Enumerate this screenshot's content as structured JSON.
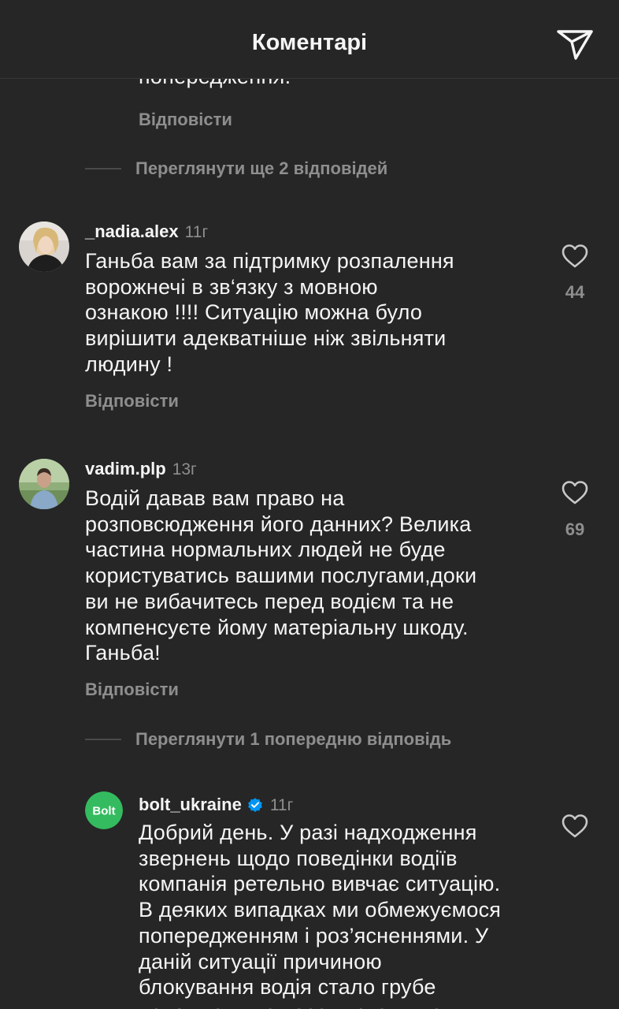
{
  "header": {
    "title": "Коментарі",
    "send_icon": "send-icon"
  },
  "prev_comment": {
    "text_tail": "попередження.",
    "reply_label": "Відповісти"
  },
  "thread1_more": "Переглянути ще 2 відповідей",
  "comments": [
    {
      "username": "_nadia.alex",
      "time": "11г",
      "text": "Ганьба вам за підтримку розпалення\nворожнечі в зв‘язку з мовною\nознакою !!!! Ситуацію можна було\nвирішити адекватніше ніж звільняти\nлюдину !",
      "likes": "44",
      "reply_label": "Відповісти"
    },
    {
      "username": "vadim.plp",
      "time": "13г",
      "text": "Водій давав вам право на\nрозповсюдження його данних? Велика\nчастина нормальних людей не буде\nкористуватись вашими послугами,доки\nви не вибачитесь перед водієм та не\nкомпенсуєте йому матеріальну шкоду.\nГаньба!",
      "likes": "69",
      "reply_label": "Відповісти"
    }
  ],
  "thread2_more": "Переглянути 1 попередню відповідь",
  "brand_reply": {
    "username": "bolt_ukraine",
    "verified": true,
    "time": "11г",
    "avatar_text": "Bolt",
    "text": "Добрий день. У разі надходження\nзвернень щодо поведінки водіїв\nкомпанія ретельно вивчає ситуацію.\nВ деяких випадках ми обмежуємося\nпопередженням і роз’ясненнями. У\nданій ситуації причиною\nблокування водія  стало грубе\nповодження з пасажирками та"
  },
  "colors": {
    "background": "#262626",
    "text": "#f5f5f5",
    "secondary": "#8e8e8e",
    "bolt_green": "#34bb5f",
    "verified_blue": "#0095f6"
  }
}
